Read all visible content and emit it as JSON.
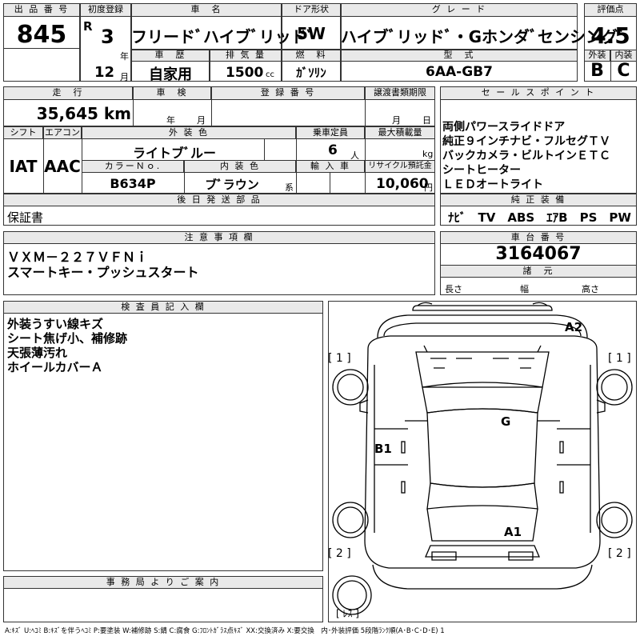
{
  "header": {
    "lot_no_label": "出 品 番 号",
    "lot_no": "845",
    "first_reg_label": "初度登録",
    "era": "R",
    "year": "3",
    "year_unit": "年",
    "month": "12",
    "month_unit": "月",
    "car_name_label": "車　名",
    "car_name": "フリードﾞハイブﾞリッドﾞ",
    "door_label": "ドア形状",
    "door": "5W",
    "grade_label": "グ レ ー ド",
    "grade": "ハイブﾞリッドﾞ・Gホンダﾞセンシングﾞ",
    "score_label": "評価点",
    "score": "4.5",
    "history_label": "車　歴",
    "history": "自家用",
    "displacement_label": "排 気 量",
    "displacement": "1500",
    "displacement_unit": "cc",
    "fuel_label": "燃　料",
    "fuel": "ｶﾞｿﾘﾝ",
    "model_label": "型　式",
    "model": "6AA-GB7",
    "exterior_label": "外装",
    "exterior": "B",
    "interior_label": "内装",
    "interior": "C"
  },
  "row2": {
    "mileage_label": "走　行",
    "mileage": "35,645 km",
    "inspection_label": "車　検",
    "insp_year_unit": "年",
    "insp_month_unit": "月",
    "plate_label": "登 録 番 号",
    "transfer_label": "譲渡書類期限",
    "transfer_month_unit": "月",
    "transfer_day_unit": "日",
    "sales_label": "セ ー ル ス ポ イ ン ト",
    "sales_points": [
      "両側パワースライドドア",
      "純正９インチナビ・フルセグＴＶ",
      "バックカメラ・ビルトインＥＴＣ",
      "シートヒーター",
      "ＬＥＤオートライト"
    ]
  },
  "row3": {
    "shift_label": "シフト",
    "shift": "IAT",
    "ac_label": "エアコン",
    "ac": "AAC",
    "ext_color_label": "外 装 色",
    "ext_color": "ライトブﾞルー",
    "capacity_label": "乗車定員",
    "capacity": "6",
    "capacity_unit": "人",
    "load_label": "最大積載量",
    "load_unit": "kg",
    "color_no_label": "カラーＮｏ.",
    "color_no": "B634P",
    "int_color_label": "内 装 色",
    "int_color": "ブﾞラウン",
    "int_color_unit": "系",
    "import_label": "輸 入 車",
    "recycle_label": "リサイクル預託金",
    "recycle": "10,060",
    "recycle_unit": "円"
  },
  "later_parts": {
    "label": "後 日 発 送 部 品",
    "value": "保証書"
  },
  "genuine": {
    "label": "純 正 装 備",
    "value": "ﾅﾋﾞ　TV　ABS　ｴｱB　PS　PW"
  },
  "notes": {
    "label": "注 意 事 項 欄",
    "lines": [
      "ＶＸＭ－２２７ＶＦＮｉ",
      "スマートキー・プッシュスタート"
    ]
  },
  "chassis": {
    "label": "車 台 番 号",
    "value": "3164067"
  },
  "specs": {
    "label": "諸　元",
    "length": "長さ",
    "width": "幅",
    "height": "高さ"
  },
  "inspector": {
    "label": "検 査 員 記 入 欄",
    "lines": [
      "外装うすい線キズ",
      "シート焦げ小、補修跡",
      "天張薄汚れ",
      "ホイールカバーＡ"
    ]
  },
  "office": {
    "label": "事 務 局 よ り ご 案 内"
  },
  "diagram": {
    "marks": {
      "a2": "A2",
      "g": "G",
      "b1": "B1",
      "a1": "A1"
    },
    "tyres": {
      "fl": "[ 1 ]",
      "fr": "[ 1 ]",
      "rl": "[ 2 ]",
      "rr": "[ 2 ]",
      "spare": "[ ﾚｽ ]"
    }
  },
  "legend": "A:ｷｽﾞ U:ﾍｺﾐ B:ｷｽﾞを伴うﾍｺﾐ P:要塗装 W:補修跡 S:錆 C:腐食 G:ﾌﾛﾝﾄｶﾞﾗｽ点ｷｽﾞ XX:交換済み X:要交換　内･外装評価 5段階ﾗﾝｸ順(A･B･C･D･E) 1"
}
